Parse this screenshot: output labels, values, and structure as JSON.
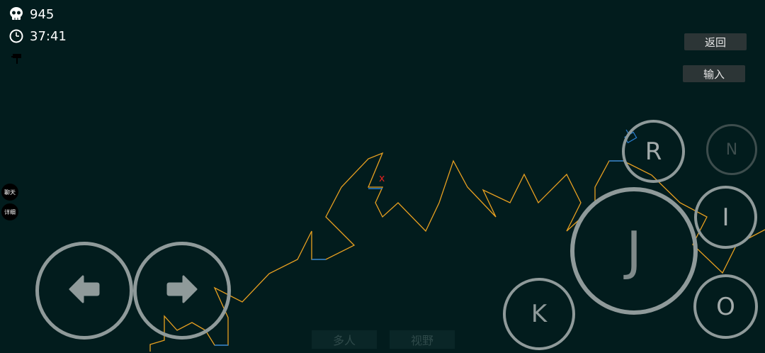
{
  "hud": {
    "kills": "945",
    "time": "37:41",
    "kills_icon": "skull-icon",
    "time_icon": "clock-icon",
    "extra_icon": "turret-icon"
  },
  "menu": {
    "back_label": "返回",
    "input_label": "输入"
  },
  "side": {
    "chat_label": "聊天",
    "detail_label": "详细"
  },
  "controls": {
    "left_icon": "arrow-left-icon",
    "right_icon": "arrow-right-icon",
    "j_label": "J",
    "k_label": "K",
    "r_label": "R",
    "n_label": "N",
    "i_label": "I",
    "o_label": "O"
  },
  "tabs": {
    "multiplayer_label": "多人",
    "view_label": "视野"
  },
  "map": {
    "marker_label": "x"
  },
  "colors": {
    "background": "#021c1d",
    "terrain": "#e8a020",
    "platform": "#2a7fd0",
    "marker": "#e02020",
    "ring": "#8f9a9a"
  }
}
